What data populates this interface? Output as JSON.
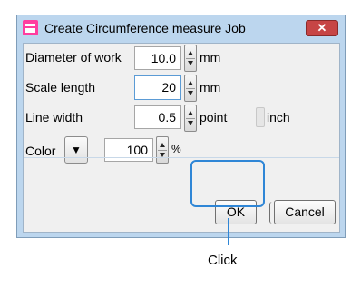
{
  "window": {
    "title": "Create Circumference measure Job",
    "close_glyph": "✕"
  },
  "fields": {
    "diameter": {
      "label": "Diameter of work",
      "value": "10.0",
      "unit": "mm"
    },
    "scale": {
      "label": "Scale length",
      "value": "20",
      "unit": "mm"
    },
    "line_width": {
      "label": "Line width",
      "value": "0.5",
      "unit_point": "point",
      "unit_inch": "inch"
    },
    "color": {
      "label": "Color",
      "dropdown_glyph": "▼",
      "value": "100",
      "unit": "%"
    }
  },
  "buttons": {
    "ok": "OK",
    "cancel": "Cancel"
  },
  "annotation": {
    "label": "Click",
    "color": "#2f86d6"
  },
  "colors": {
    "title_bar": "#bcd6ee",
    "close_button": "#c74545",
    "app_icon": "#ff3ea0"
  }
}
